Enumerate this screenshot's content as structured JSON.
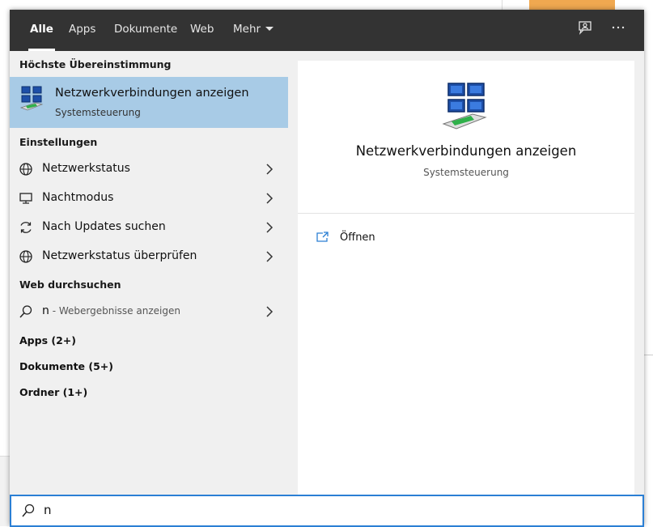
{
  "tabs": [
    {
      "label": "Alle"
    },
    {
      "label": "Apps"
    },
    {
      "label": "Dokumente"
    },
    {
      "label": "Web"
    },
    {
      "label": "Mehr"
    }
  ],
  "sections": {
    "best_match": "Höchste Übereinstimmung",
    "settings": "Einstellungen",
    "web": "Web durchsuchen"
  },
  "best_match": {
    "title": "Netzwerkverbindungen anzeigen",
    "subtitle": "Systemsteuerung"
  },
  "settings_items": [
    {
      "label": "Netzwerkstatus",
      "icon": "globe-icon"
    },
    {
      "label": "Nachtmodus",
      "icon": "monitor-icon"
    },
    {
      "label": "Nach Updates suchen",
      "icon": "refresh-icon"
    },
    {
      "label": "Netzwerkstatus überprüfen",
      "icon": "globe-icon"
    }
  ],
  "web_item": {
    "query": "n",
    "suffix": " - Webergebnisse anzeigen"
  },
  "categories": [
    {
      "label": "Apps (2+)"
    },
    {
      "label": "Dokumente (5+)"
    },
    {
      "label": "Ordner (1+)"
    }
  ],
  "detail": {
    "title": "Netzwerkverbindungen anzeigen",
    "subtitle": "Systemsteuerung",
    "action_label": "Öffnen"
  },
  "search": {
    "value": "n"
  },
  "colors": {
    "topbar": "#333333",
    "selected": "#a8cbe6",
    "accent": "#2b7fd4"
  }
}
